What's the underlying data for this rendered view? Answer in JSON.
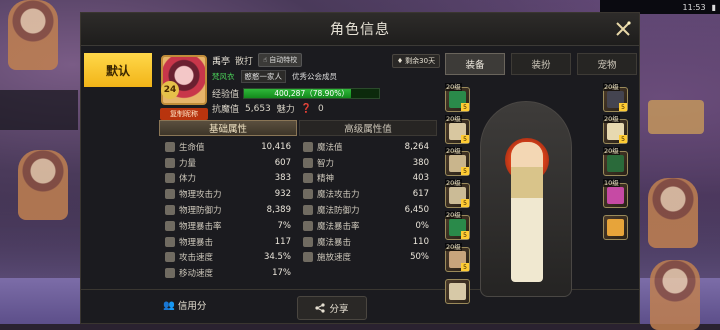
{
  "window": {
    "title": "角色信息"
  },
  "left_tab": {
    "label": "默认"
  },
  "player": {
    "level": "24",
    "name": "禹亭",
    "class": "散打",
    "auto_label": "自动特校",
    "guild_name": "梵风衣",
    "guild_tag": "憨憨一家人",
    "guild_desc": "优秀公会成员",
    "exp_label": "经验值",
    "exp_text": "400,287（78.90%）",
    "exp_fraction": 0.789,
    "resist_label": "抗魔值",
    "resist_value": "5,653",
    "charm_label": "魅力",
    "charm_value": "0",
    "copy_label": "复制昵称",
    "vip_text": "剩余30天"
  },
  "right_tabs": [
    {
      "label": "装备",
      "active": true
    },
    {
      "label": "装扮",
      "active": false
    },
    {
      "label": "宠物",
      "active": false
    }
  ],
  "stats_tabs": {
    "basic": "基础属性",
    "advanced": "高级属性值"
  },
  "stats": [
    [
      {
        "label": "生命值",
        "value": "10,416"
      },
      {
        "label": "魔法值",
        "value": "8,264"
      }
    ],
    [
      {
        "label": "力量",
        "value": "607"
      },
      {
        "label": "智力",
        "value": "380"
      }
    ],
    [
      {
        "label": "体力",
        "value": "383"
      },
      {
        "label": "精神",
        "value": "403"
      }
    ],
    [
      {
        "label": "物理攻击力",
        "value": "932"
      },
      {
        "label": "魔法攻击力",
        "value": "617"
      }
    ],
    [
      {
        "label": "物理防御力",
        "value": "8,389"
      },
      {
        "label": "魔法防御力",
        "value": "6,450"
      }
    ],
    [
      {
        "label": "物理暴击率",
        "value": "7%"
      },
      {
        "label": "魔法暴击率",
        "value": "0%"
      }
    ],
    [
      {
        "label": "物理暴击",
        "value": "117"
      },
      {
        "label": "魔法暴击",
        "value": "110"
      }
    ],
    [
      {
        "label": "攻击速度",
        "value": "34.5%"
      },
      {
        "label": "施放速度",
        "value": "50%"
      }
    ],
    [
      {
        "label": "移动速度",
        "value": "17%"
      }
    ]
  ],
  "bottom": {
    "credit_label": "信用分",
    "share_label": "分享"
  },
  "equipment_left": [
    {
      "level": "20级",
      "gem": "5",
      "color": "#2a8a4a"
    },
    {
      "level": "20级",
      "gem": "5",
      "color": "#d8c7a0"
    },
    {
      "level": "20级",
      "gem": "5",
      "color": "#c9b58c"
    },
    {
      "level": "20级",
      "gem": "5",
      "color": "#cbbb96"
    },
    {
      "level": "20级",
      "gem": "5",
      "color": "#2a8a4a"
    },
    {
      "level": "20级",
      "gem": "5",
      "color": "#c7a47c"
    },
    {
      "level": "",
      "gem": "",
      "color": "#d7c9a7"
    }
  ],
  "equipment_right": [
    {
      "level": "20级",
      "gem": "5",
      "color": "#444450"
    },
    {
      "level": "20级",
      "gem": "5",
      "color": "#e7d9b0"
    },
    {
      "level": "20级",
      "gem": "",
      "color": "#2a6a3a"
    },
    {
      "level": "10级",
      "gem": "",
      "color": "#c64aa4"
    },
    {
      "level": "",
      "gem": "",
      "color": "#e7a43a"
    }
  ],
  "status_bar": {
    "time": "11:53"
  },
  "colors": {
    "accent": "#f2b418",
    "exp_bar": "#2fb83a",
    "copy_btn": "#b8340e",
    "guild": "#4bd35a"
  }
}
